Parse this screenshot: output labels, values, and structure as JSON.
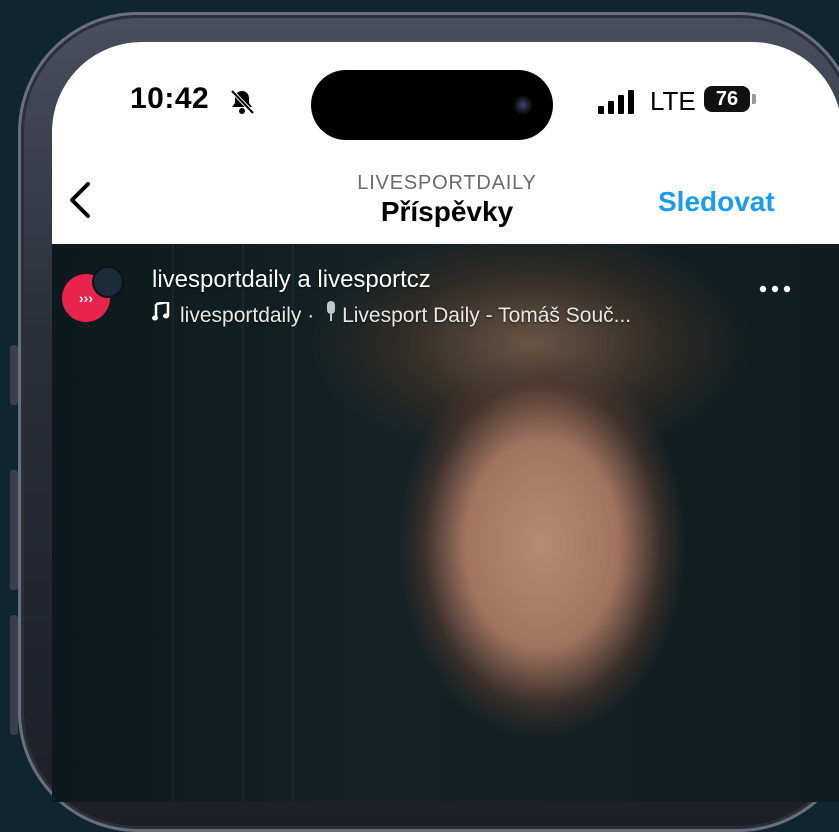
{
  "status_bar": {
    "time": "10:42",
    "carrier": "LTE",
    "battery": "76"
  },
  "nav": {
    "subtitle": "LIVESPORTDAILY",
    "title": "Příspěvky",
    "follow_label": "Sledovat"
  },
  "post": {
    "author": "livesportdaily a livesportcz",
    "audio_user": "livesportdaily",
    "separator": "·",
    "audio_title": "Livesport Daily - Tomáš Souč..."
  },
  "icons": {
    "bell": "bell-slash-icon",
    "signal": "cellular-signal-icon",
    "back": "chevron-left-icon",
    "music": "music-note-icon",
    "mic": "microphone-icon",
    "more": "more-dots-icon"
  },
  "colors": {
    "accent": "#1a9bf0",
    "brand_red": "#e9244c",
    "background": "#0f2530"
  }
}
